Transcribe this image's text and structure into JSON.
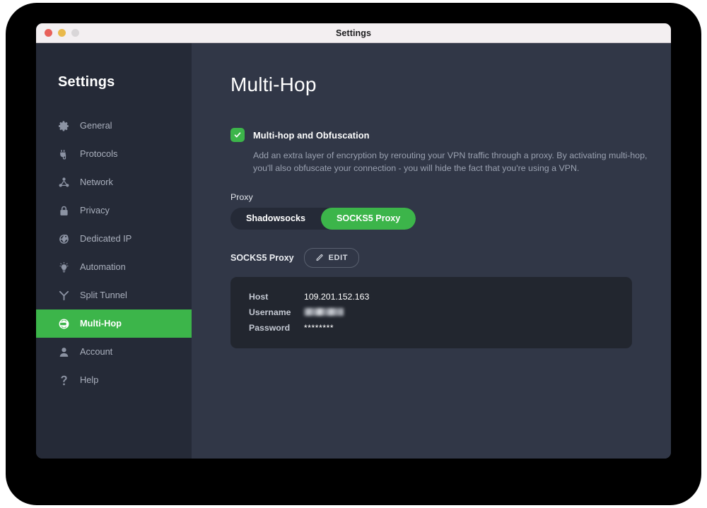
{
  "window": {
    "title": "Settings",
    "traffic_lights": [
      "close",
      "minimize",
      "maximize"
    ]
  },
  "sidebar": {
    "title": "Settings",
    "items": [
      {
        "label": "General",
        "icon": "gear-icon",
        "active": false
      },
      {
        "label": "Protocols",
        "icon": "plug-icon",
        "active": false
      },
      {
        "label": "Network",
        "icon": "network-icon",
        "active": false
      },
      {
        "label": "Privacy",
        "icon": "lock-icon",
        "active": false
      },
      {
        "label": "Dedicated IP",
        "icon": "globe-pin-icon",
        "active": false
      },
      {
        "label": "Automation",
        "icon": "lightbulb-icon",
        "active": false
      },
      {
        "label": "Split Tunnel",
        "icon": "split-fork-icon",
        "active": false
      },
      {
        "label": "Multi-Hop",
        "icon": "multi-hop-icon",
        "active": true
      },
      {
        "label": "Account",
        "icon": "person-icon",
        "active": false
      },
      {
        "label": "Help",
        "icon": "question-mark-icon",
        "active": false
      }
    ]
  },
  "main": {
    "page_title": "Multi-Hop",
    "toggle": {
      "label": "Multi-hop and Obfuscation",
      "checked": true
    },
    "description": "Add an extra layer of encryption by rerouting your VPN traffic through a proxy. By activating multi-hop, you'll also obfuscate your connection - you will hide the fact that you're using a VPN.",
    "proxy_section": {
      "label": "Proxy",
      "options": [
        "Shadowsocks",
        "SOCKS5 Proxy"
      ],
      "selected": "SOCKS5 Proxy"
    },
    "details": {
      "heading": "SOCKS5 Proxy",
      "edit_label": "EDIT",
      "rows": [
        {
          "key": "Host",
          "value": "109.201.152.163",
          "style": "text"
        },
        {
          "key": "Username",
          "value": "",
          "style": "redacted"
        },
        {
          "key": "Password",
          "value": "********",
          "style": "dots"
        }
      ]
    }
  },
  "colors": {
    "accent_green": "#3cb54a",
    "sidebar_bg": "#252a37",
    "content_bg": "#313747",
    "card_bg": "#22262f",
    "titlebar_bg": "#f3eff1",
    "frame_black": "#000000"
  }
}
